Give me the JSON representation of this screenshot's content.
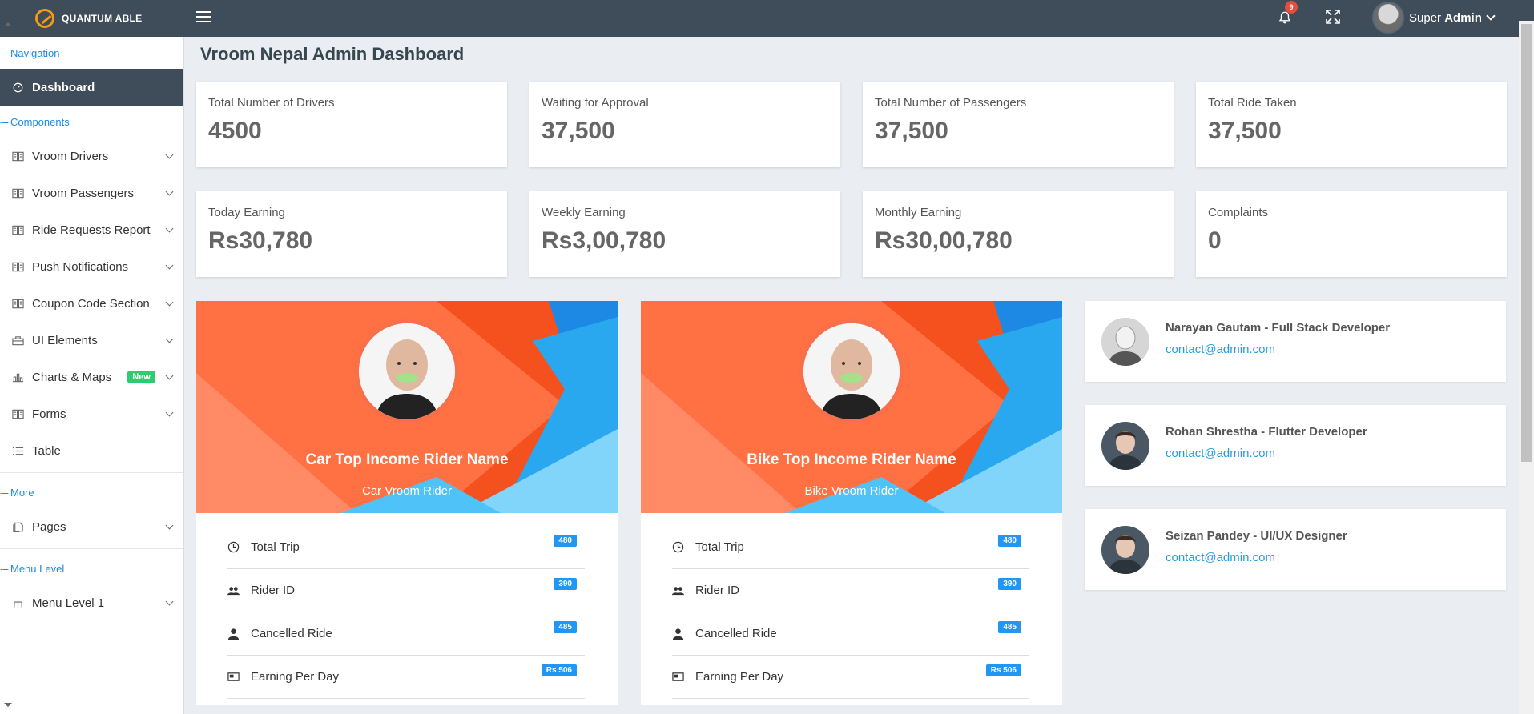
{
  "brand": {
    "name": "QUANTUM ABLE"
  },
  "topbar": {
    "notification_count": "9",
    "user_first": "Super",
    "user_last": "Admin"
  },
  "sidebar": {
    "captions": {
      "navigation": "Navigation",
      "components": "Components",
      "more": "More",
      "menu_level": "Menu Level"
    },
    "dashboard": "Dashboard",
    "items": [
      {
        "label": "Vroom Drivers"
      },
      {
        "label": "Vroom Passengers"
      },
      {
        "label": "Ride Requests Report"
      },
      {
        "label": "Push Notifications"
      },
      {
        "label": "Coupon Code Section"
      },
      {
        "label": "UI Elements"
      },
      {
        "label": "Charts & Maps",
        "badge": "New"
      },
      {
        "label": "Forms"
      },
      {
        "label": "Table"
      }
    ],
    "pages": "Pages",
    "menu_level_1": "Menu Level 1"
  },
  "page": {
    "title": "Vroom Nepal Admin Dashboard"
  },
  "stats": [
    {
      "label": "Total Number of Drivers",
      "value": "4500"
    },
    {
      "label": "Waiting for Approval",
      "value": "37,500"
    },
    {
      "label": "Total Number of Passengers",
      "value": "37,500"
    },
    {
      "label": "Total Ride Taken",
      "value": "37,500"
    },
    {
      "label": "Today Earning",
      "value": "Rs30,780"
    },
    {
      "label": "Weekly Earning",
      "value": "Rs3,00,780"
    },
    {
      "label": "Monthly Earning",
      "value": "Rs30,00,780"
    },
    {
      "label": "Complaints",
      "value": "0"
    }
  ],
  "profiles": [
    {
      "name": "Car Top Income Rider Name",
      "subtitle": "Car Vroom Rider",
      "rows": [
        {
          "label": "Total Trip",
          "badge": "480"
        },
        {
          "label": "Rider ID",
          "badge": "390"
        },
        {
          "label": "Cancelled Ride",
          "badge": "485"
        },
        {
          "label": "Earning Per Day",
          "badge": "Rs 506"
        }
      ]
    },
    {
      "name": "Bike Top Income Rider Name",
      "subtitle": "Bike Vroom Rider",
      "rows": [
        {
          "label": "Total Trip",
          "badge": "480"
        },
        {
          "label": "Rider ID",
          "badge": "390"
        },
        {
          "label": "Cancelled Ride",
          "badge": "485"
        },
        {
          "label": "Earning Per Day",
          "badge": "Rs 506"
        }
      ]
    }
  ],
  "contacts": [
    {
      "name": "Narayan Gautam - Full Stack Developer",
      "email": "contact@admin.com"
    },
    {
      "name": "Rohan Shrestha - Flutter Developer",
      "email": "contact@admin.com"
    },
    {
      "name": "Seizan Pandey - UI/UX Designer",
      "email": "contact@admin.com"
    }
  ],
  "colors": {
    "topbar": "#3f4d5a",
    "accent": "#2196f3",
    "cover_orange": "#f4511e",
    "cover_blue": "#29a8f0",
    "new_badge": "#2ecc71"
  },
  "icons": [
    "logo-icon",
    "menu-icon",
    "bell-icon",
    "fullscreen-icon",
    "dashboard-icon",
    "book-icon",
    "briefcase-icon",
    "chart-icon",
    "list-icon",
    "pages-icon",
    "sitemap-icon",
    "clock-icon",
    "users-icon",
    "user-icon",
    "card-icon"
  ]
}
